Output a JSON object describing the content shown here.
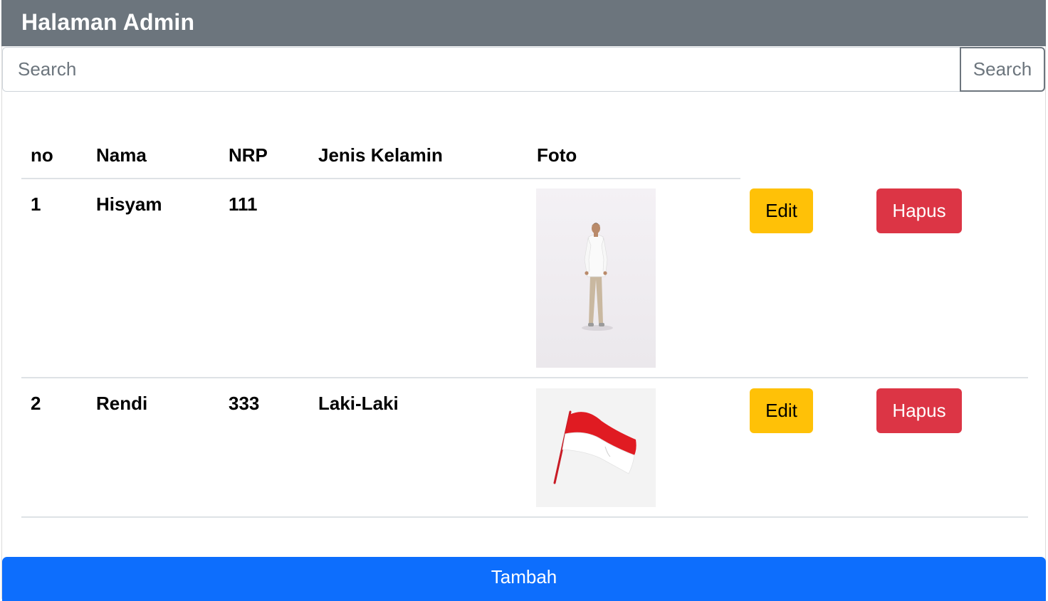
{
  "header": {
    "title": "Halaman Admin"
  },
  "search": {
    "placeholder": "Search",
    "value": "",
    "button_label": "Search"
  },
  "table": {
    "columns": [
      "no",
      "Nama",
      "NRP",
      "Jenis Kelamin",
      "Foto"
    ],
    "rows": [
      {
        "no": "1",
        "nama": "Hisyam",
        "nrp": "111",
        "jenis_kelamin": "",
        "foto": "person-photo",
        "edit_label": "Edit",
        "hapus_label": "Hapus"
      },
      {
        "no": "2",
        "nama": "Rendi",
        "nrp": "333",
        "jenis_kelamin": "Laki-Laki",
        "foto": "flag-photo",
        "edit_label": "Edit",
        "hapus_label": "Hapus"
      }
    ]
  },
  "footer": {
    "tambah_label": "Tambah"
  },
  "colors": {
    "header_bg": "#6c757d",
    "edit": "#ffc107",
    "hapus": "#dc3545",
    "tambah": "#0d6efd"
  }
}
